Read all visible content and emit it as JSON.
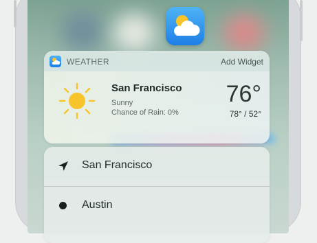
{
  "widget": {
    "app_name": "WEATHER",
    "add_widget_label": "Add Widget",
    "city": "San Francisco",
    "condition": "Sunny",
    "rain_label": "Chance of Rain: 0%",
    "temperature": "76°",
    "hi_lo": "78° / 52°"
  },
  "quick_actions": [
    {
      "label": "San Francisco",
      "icon": "location-arrow-icon"
    },
    {
      "label": "Austin",
      "icon": "dot-icon"
    }
  ],
  "colors": {
    "weather_blue": "#1d7fe6",
    "sun_yellow": "#f7c52b"
  }
}
